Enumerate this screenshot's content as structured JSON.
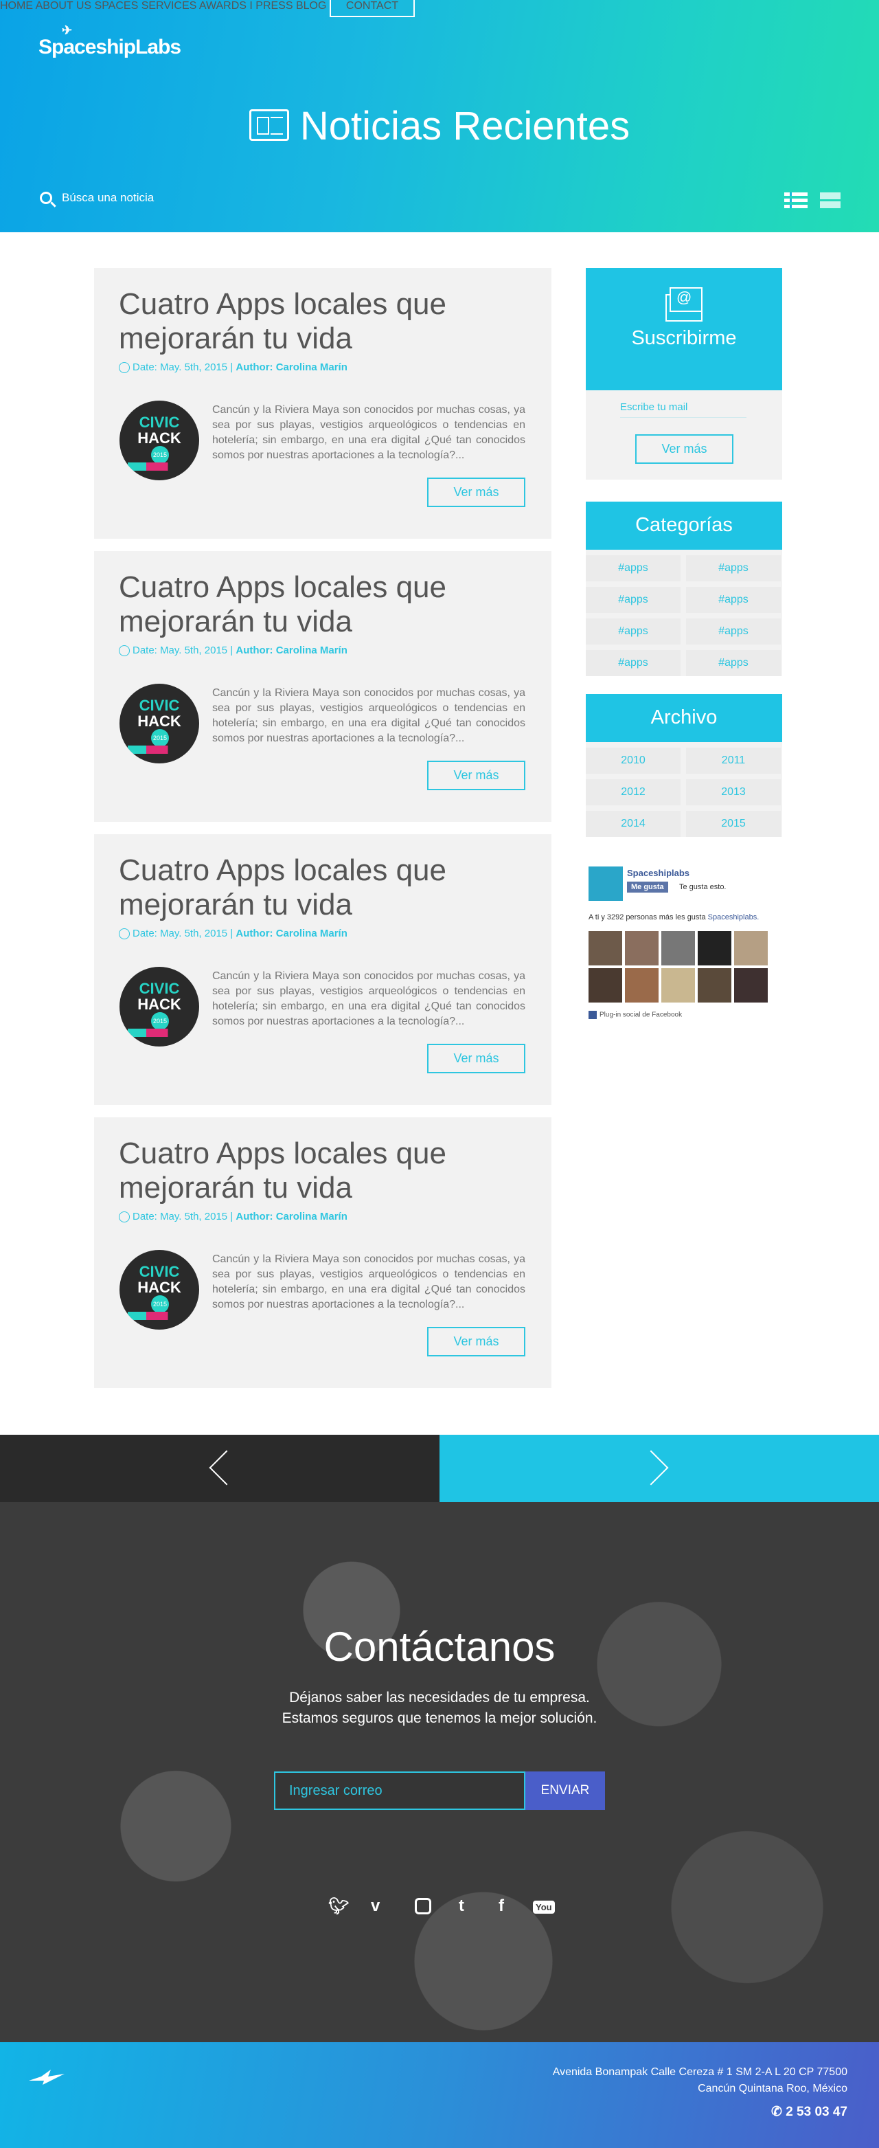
{
  "header": {
    "logo": "SpaceshipLabs",
    "nav": [
      "HOME",
      "ABOUT US",
      "SPACES",
      "SERVICES",
      "AWARDS I PRESS",
      "BLOG"
    ],
    "contact_label": "CONTACT",
    "page_title": "Noticias Recientes",
    "search_placeholder": "Búsca una noticia"
  },
  "articles": [
    {
      "title": "Cuatro Apps locales que mejorarán tu vida",
      "date": "Date: May. 5th, 2015 |",
      "author": "Author: Carolina Marín",
      "excerpt": "Cancún y la Riviera Maya son conocidos por muchas cosas, ya sea por sus playas, vestigios arqueológicos o tendencias en hotelería; sin embargo, en una era digital ¿Qué tan conocidos somos por nuestras aportaciones a la tecnología?...",
      "more": "Ver más",
      "thumb_line1": "CIVIC",
      "thumb_line2": "HACK",
      "thumb_year": "2015"
    },
    {
      "title": "Cuatro Apps locales que mejorarán tu vida",
      "date": "Date: May. 5th, 2015 |",
      "author": "Author: Carolina Marín",
      "excerpt": "Cancún y la Riviera Maya son conocidos por muchas cosas, ya sea por sus playas, vestigios arqueológicos o tendencias en hotelería; sin embargo, en una era digital ¿Qué tan conocidos somos por nuestras aportaciones a la tecnología?...",
      "more": "Ver más",
      "thumb_line1": "CIVIC",
      "thumb_line2": "HACK",
      "thumb_year": "2015"
    },
    {
      "title": "Cuatro Apps locales que mejorarán tu vida",
      "date": "Date: May. 5th, 2015 |",
      "author": "Author: Carolina Marín",
      "excerpt": "Cancún y la Riviera Maya son conocidos por muchas cosas, ya sea por sus playas, vestigios arqueológicos o tendencias en hotelería; sin embargo, en una era digital ¿Qué tan conocidos somos por nuestras aportaciones a la tecnología?...",
      "more": "Ver más",
      "thumb_line1": "CIVIC",
      "thumb_line2": "HACK",
      "thumb_year": "2015"
    },
    {
      "title": "Cuatro Apps locales que mejorarán tu vida",
      "date": "Date: May. 5th, 2015 |",
      "author": "Author: Carolina Marín",
      "excerpt": "Cancún y la Riviera Maya son conocidos por muchas cosas, ya sea por sus playas, vestigios arqueológicos o tendencias en hotelería; sin embargo, en una era digital ¿Qué tan conocidos somos por nuestras aportaciones a la tecnología?...",
      "more": "Ver más",
      "thumb_line1": "CIVIC",
      "thumb_line2": "HACK",
      "thumb_year": "2015"
    }
  ],
  "sidebar": {
    "subscribe_title": "Suscribirme",
    "email_placeholder": "Escribe tu mail",
    "subscribe_more": "Ver más",
    "categories_title": "Categorías",
    "categories": [
      "#apps",
      "#apps",
      "#apps",
      "#apps",
      "#apps",
      "#apps",
      "#apps",
      "#apps"
    ],
    "archive_title": "Archivo",
    "years": [
      "2010",
      "2011",
      "2012",
      "2013",
      "2014",
      "2015"
    ]
  },
  "facebook": {
    "page_name": "Spaceshiplabs",
    "like_label": "Me gusta",
    "like_note": "Te gusta esto.",
    "count_text": "A ti y 3292 personas más les gusta",
    "count_page": "Spaceshiplabs.",
    "plugin_label": "Plug-in social de Facebook"
  },
  "contact": {
    "title": "Contáctanos",
    "line1": "Déjanos saber las necesidades de tu empresa.",
    "line2": "Estamos seguros que tenemos la mejor solución.",
    "email_placeholder": "Ingresar correo",
    "send_label": "ENVIAR",
    "socials": [
      "twitter-icon",
      "vimeo-icon",
      "instagram-icon",
      "tumblr-icon",
      "facebook-icon",
      "youtube-icon"
    ]
  },
  "footer": {
    "address1": "Avenida Bonampak Calle Cereza # 1 SM 2-A L 20 CP 77500",
    "address2": "Cancún Quintana Roo, México",
    "phone": "2 53 03 47"
  },
  "colors": {
    "accent": "#1fc4e4",
    "dark": "#2a2a2a",
    "button": "#4a5ec9"
  }
}
